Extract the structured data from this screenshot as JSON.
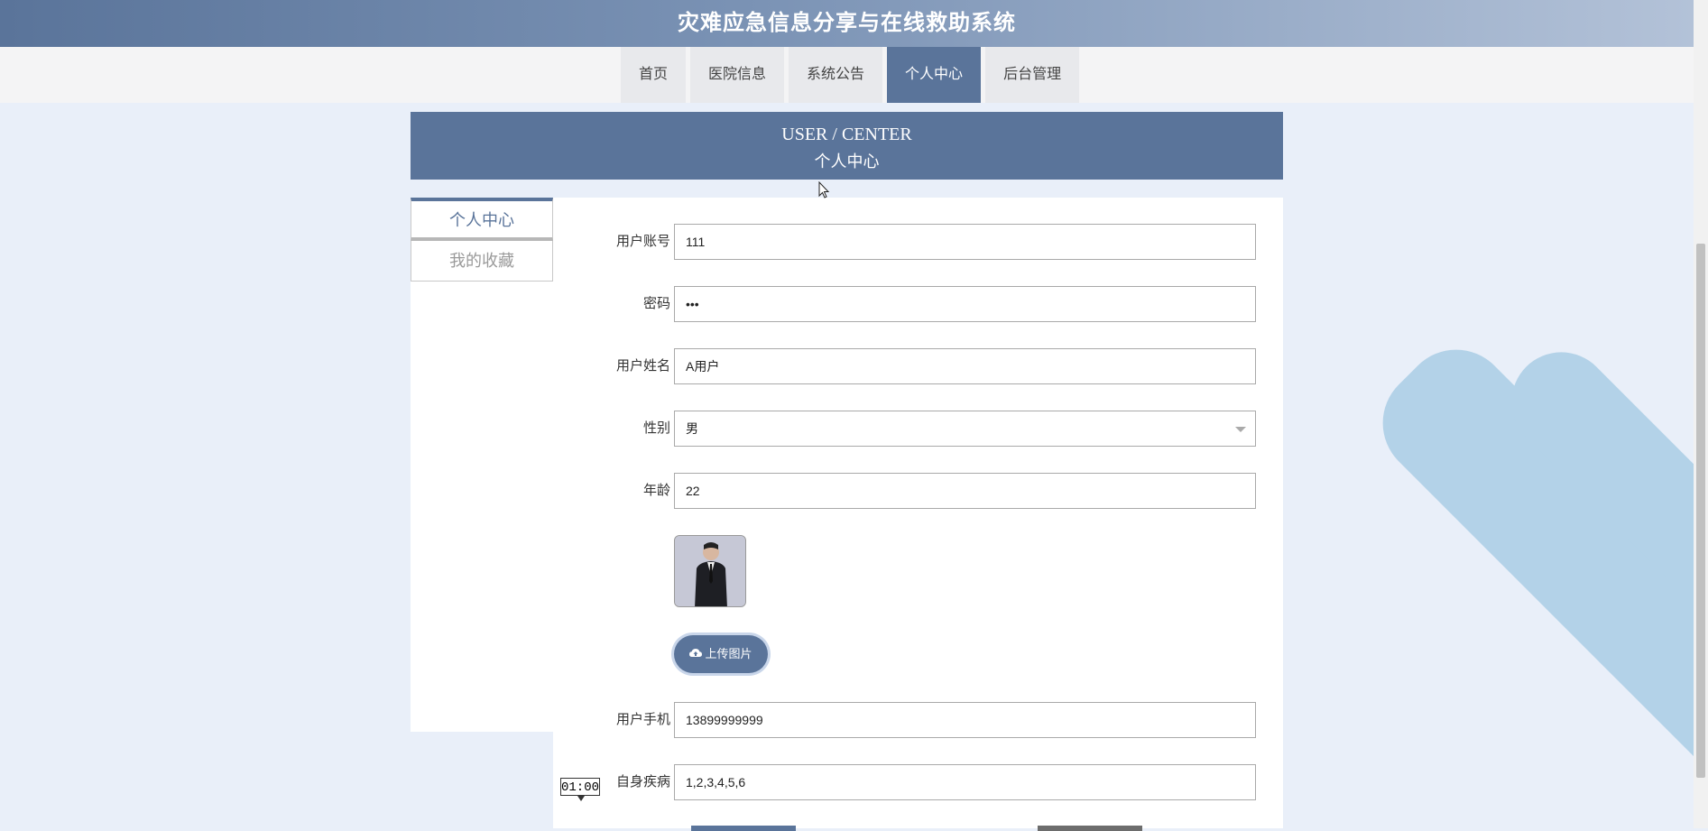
{
  "header": {
    "title": "灾难应急信息分享与在线救助系统"
  },
  "nav": {
    "items": [
      {
        "label": "首页"
      },
      {
        "label": "医院信息"
      },
      {
        "label": "系统公告"
      },
      {
        "label": "个人中心"
      },
      {
        "label": "后台管理"
      }
    ],
    "active": "个人中心"
  },
  "banner": {
    "en": "USER / CENTER",
    "cn": "个人中心"
  },
  "sidebar": {
    "items": [
      {
        "label": "个人中心"
      },
      {
        "label": "我的收藏"
      }
    ]
  },
  "form": {
    "account": {
      "label": "用户账号",
      "value": "111"
    },
    "password": {
      "label": "密码",
      "value": "•••"
    },
    "name": {
      "label": "用户姓名",
      "value": "A用户"
    },
    "gender": {
      "label": "性别",
      "value": "男"
    },
    "age": {
      "label": "年龄",
      "value": "22"
    },
    "upload_label": "上传图片",
    "phone": {
      "label": "用户手机",
      "value": "13899999999"
    },
    "disease": {
      "label": "自身疾病",
      "value": "1,2,3,4,5,6"
    }
  },
  "timer": "01:00",
  "colors": {
    "primary": "#5a749a",
    "background": "#e9eff9",
    "deco": "#b3d2e8"
  }
}
